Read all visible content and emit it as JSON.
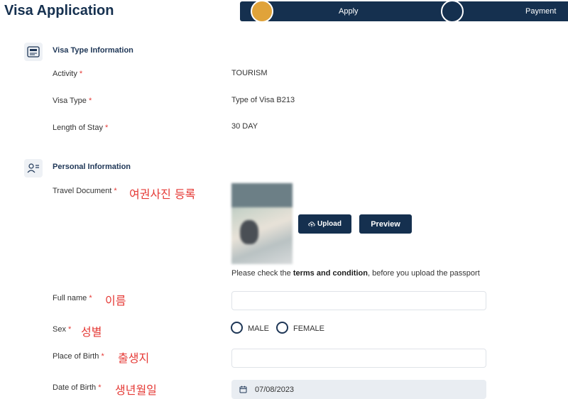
{
  "header": {
    "title": "Visa Application"
  },
  "stepper": {
    "steps": [
      {
        "label": "Apply"
      },
      {
        "label": "Payment"
      }
    ]
  },
  "visa_type": {
    "title": "Visa Type Information",
    "icon": "visa-card-icon",
    "fields": [
      {
        "label": "Activity",
        "value": "TOURISM"
      },
      {
        "label": "Visa Type",
        "value": "Type of Visa B213"
      },
      {
        "label": "Length of Stay",
        "value": "30 DAY"
      }
    ]
  },
  "personal": {
    "title": "Personal Information",
    "icon": "person-card-icon",
    "travel_document": {
      "label": "Travel Document",
      "annotation": "여권사진 등록"
    },
    "upload_label": "Upload",
    "preview_label": "Preview",
    "hint": {
      "pre": "Please check the ",
      "bold": "terms and condition",
      "post": ", before you upload the passport"
    },
    "full_name": {
      "label": "Full name",
      "annotation": "이름",
      "value": ""
    },
    "sex": {
      "label": "Sex",
      "annotation": "성별",
      "options": [
        "MALE",
        "FEMALE"
      ]
    },
    "place_of_birth": {
      "label": "Place of Birth",
      "annotation": "출생지",
      "value": ""
    },
    "date_of_birth": {
      "label": "Date of Birth",
      "annotation": "생년월일",
      "value": "07/08/2023"
    }
  },
  "required_mark": "*",
  "colors": {
    "primary": "#15304f",
    "accent": "#e0a33a",
    "required": "#e53935"
  }
}
